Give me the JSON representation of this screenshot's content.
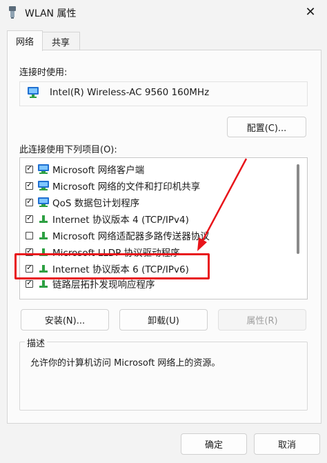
{
  "window": {
    "title": "WLAN 属性"
  },
  "tabs": [
    {
      "label": "网络"
    },
    {
      "label": "共享"
    }
  ],
  "connect_using": {
    "label": "连接时使用:",
    "adapter": "Intel(R) Wireless-AC 9560 160MHz",
    "configure_label": "配置(C)..."
  },
  "items_section": {
    "label": "此连接使用下列项目(O):",
    "items": [
      {
        "label": "Microsoft 网络客户端",
        "checked": true,
        "icon": "network-client-icon"
      },
      {
        "label": "Microsoft 网络的文件和打印机共享",
        "checked": true,
        "icon": "file-printer-sharing-icon"
      },
      {
        "label": "QoS 数据包计划程序",
        "checked": true,
        "icon": "qos-scheduler-icon"
      },
      {
        "label": "Internet 协议版本 4 (TCP/IPv4)",
        "checked": true,
        "icon": "protocol-icon"
      },
      {
        "label": "Microsoft 网络适配器多路传送器协议",
        "checked": false,
        "icon": "protocol-icon"
      },
      {
        "label": "Microsoft LLDP 协议驱动程序",
        "checked": true,
        "icon": "protocol-icon"
      },
      {
        "label": "Internet 协议版本 6 (TCP/IPv6)",
        "checked": true,
        "icon": "protocol-icon"
      },
      {
        "label": "链路层拓扑发现响应程序",
        "checked": true,
        "icon": "protocol-icon"
      }
    ]
  },
  "actions": {
    "install": "安装(N)...",
    "uninstall": "卸载(U)",
    "properties": "属性(R)"
  },
  "description": {
    "legend": "描述",
    "text": "允许你的计算机访问 Microsoft 网络上的资源。"
  },
  "footer": {
    "ok": "确定",
    "cancel": "取消"
  },
  "colors": {
    "highlight": "#e8141a",
    "icon_green": "#2ea043",
    "icon_blue": "#1f6fd1"
  }
}
